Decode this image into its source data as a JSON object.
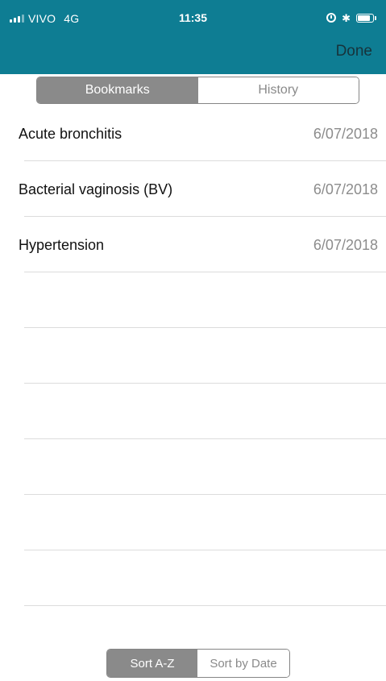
{
  "status_bar": {
    "carrier": "VIVO",
    "network": "4G",
    "time": "11:35",
    "icons": [
      "signal-icon",
      "alarm-icon",
      "bluetooth-icon",
      "battery-icon"
    ]
  },
  "nav": {
    "done_label": "Done"
  },
  "tabs": [
    {
      "label": "Bookmarks",
      "selected": true
    },
    {
      "label": "History",
      "selected": false
    }
  ],
  "bookmarks": [
    {
      "title": "Acute bronchitis",
      "date": "6/07/2018"
    },
    {
      "title": "Bacterial vaginosis (BV)",
      "date": "6/07/2018"
    },
    {
      "title": "Hypertension",
      "date": "6/07/2018"
    }
  ],
  "sort": {
    "options": [
      {
        "label": "Sort A-Z",
        "selected": true
      },
      {
        "label": "Sort by Date",
        "selected": false
      }
    ]
  },
  "colors": {
    "header_bg": "#0e7d93",
    "done_text": "#17333b",
    "segment_active": "#8a8a8a",
    "date_text": "#8c8c8c",
    "separator": "#dcdcdc"
  }
}
